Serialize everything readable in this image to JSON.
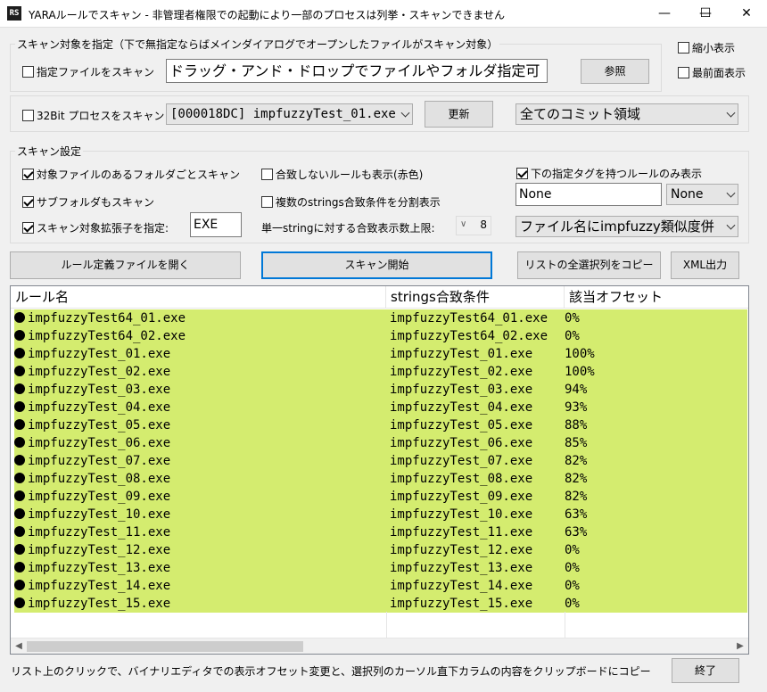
{
  "window": {
    "app_icon_text": "RS",
    "title": "YARAルールでスキャン - 非管理者権限での起動により一部のプロセスは列挙・スキャンできません",
    "minimize": "—",
    "maximize": "☐",
    "close": "✕"
  },
  "target_group": {
    "label": "スキャン対象を指定（下で無指定ならばメインダイアログでオープンしたファイルがスキャン対象）",
    "scan_file_checkbox": "指定ファイルをスキャン",
    "file_input_placeholder": "ドラッグ・アンド・ドロップでファイルやフォルダ指定可",
    "browse_button": "参照",
    "process_checkbox": "32Bit プロセスをスキャン",
    "process_combo": "[000018DC] impfuzzyTest_01.exe",
    "refresh_button": "更新",
    "region_combo": "全てのコミット領域"
  },
  "view_options": {
    "compact": "縮小表示",
    "topmost": "最前面表示"
  },
  "settings_group": {
    "label": "スキャン設定",
    "scan_folder": "対象ファイルのあるフォルダごとスキャン",
    "subfolders": "サブフォルダもスキャン",
    "ext_filter": "スキャン対象拡張子を指定:",
    "ext_value": "EXE",
    "show_unmatched": "合致しないルールも表示(赤色)",
    "split_strings": "複数のstrings合致条件を分割表示",
    "limit_label": "単一stringに対する合致表示数上限:",
    "limit_value": "8",
    "tag_filter": "下の指定タグを持つルールのみ表示",
    "tag_input": "None",
    "tag_combo": "None",
    "sort_combo": "ファイル名にimpfuzzy類似度併"
  },
  "actions": {
    "open_rules": "ルール定義ファイルを開く",
    "start_scan": "スキャン開始",
    "copy_column": "リストの全選択列をコピー",
    "xml_output": "XML出力"
  },
  "table": {
    "headers": [
      "ルール名",
      "strings合致条件",
      "該当オフセット"
    ],
    "rows": [
      [
        "impfuzzyTest64_01.exe",
        "impfuzzyTest64_01.exe",
        "0%"
      ],
      [
        "impfuzzyTest64_02.exe",
        "impfuzzyTest64_02.exe",
        "0%"
      ],
      [
        "impfuzzyTest_01.exe",
        "impfuzzyTest_01.exe",
        "100%"
      ],
      [
        "impfuzzyTest_02.exe",
        "impfuzzyTest_02.exe",
        "100%"
      ],
      [
        "impfuzzyTest_03.exe",
        "impfuzzyTest_03.exe",
        "94%"
      ],
      [
        "impfuzzyTest_04.exe",
        "impfuzzyTest_04.exe",
        "93%"
      ],
      [
        "impfuzzyTest_05.exe",
        "impfuzzyTest_05.exe",
        "88%"
      ],
      [
        "impfuzzyTest_06.exe",
        "impfuzzyTest_06.exe",
        "85%"
      ],
      [
        "impfuzzyTest_07.exe",
        "impfuzzyTest_07.exe",
        "82%"
      ],
      [
        "impfuzzyTest_08.exe",
        "impfuzzyTest_08.exe",
        "82%"
      ],
      [
        "impfuzzyTest_09.exe",
        "impfuzzyTest_09.exe",
        "82%"
      ],
      [
        "impfuzzyTest_10.exe",
        "impfuzzyTest_10.exe",
        "63%"
      ],
      [
        "impfuzzyTest_11.exe",
        "impfuzzyTest_11.exe",
        "63%"
      ],
      [
        "impfuzzyTest_12.exe",
        "impfuzzyTest_12.exe",
        "0%"
      ],
      [
        "impfuzzyTest_13.exe",
        "impfuzzyTest_13.exe",
        "0%"
      ],
      [
        "impfuzzyTest_14.exe",
        "impfuzzyTest_14.exe",
        "0%"
      ],
      [
        "impfuzzyTest_15.exe",
        "impfuzzyTest_15.exe",
        "0%"
      ]
    ],
    "row_color": "#d4ec6f"
  },
  "status": {
    "hint": "リスト上のクリックで、バイナリエディタでの表示オフセット変更と、選択列のカーソル直下カラムの内容をクリップボードにコピー",
    "exit_button": "終了"
  }
}
